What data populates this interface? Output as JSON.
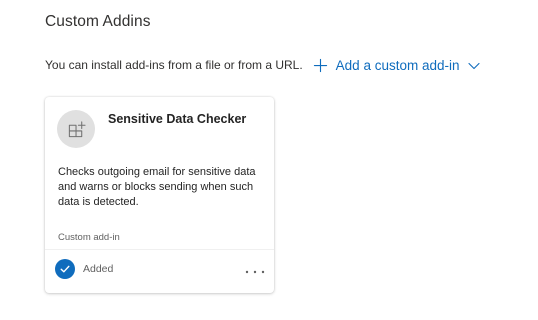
{
  "page": {
    "title": "Custom Addins",
    "intro_text": "You can install add-ins from a file or from a URL.",
    "add_button_label": "Add a custom add-in"
  },
  "addins": [
    {
      "name": "Sensitive Data Checker",
      "description": "Checks outgoing email for sensitive data and warns or blocks sending when such data is detected.",
      "type_label": "Custom add-in",
      "status": "Added",
      "icon": "addin-grid-icon"
    }
  ],
  "colors": {
    "accent": "#0f6cbd",
    "icon_circle_bg": "#e0e0e0",
    "muted_text": "#616161"
  },
  "icons": {
    "add": "plus-icon",
    "dropdown": "chevron-down-icon",
    "status": "checkmark-circle-icon",
    "more": "more-options-icon"
  }
}
